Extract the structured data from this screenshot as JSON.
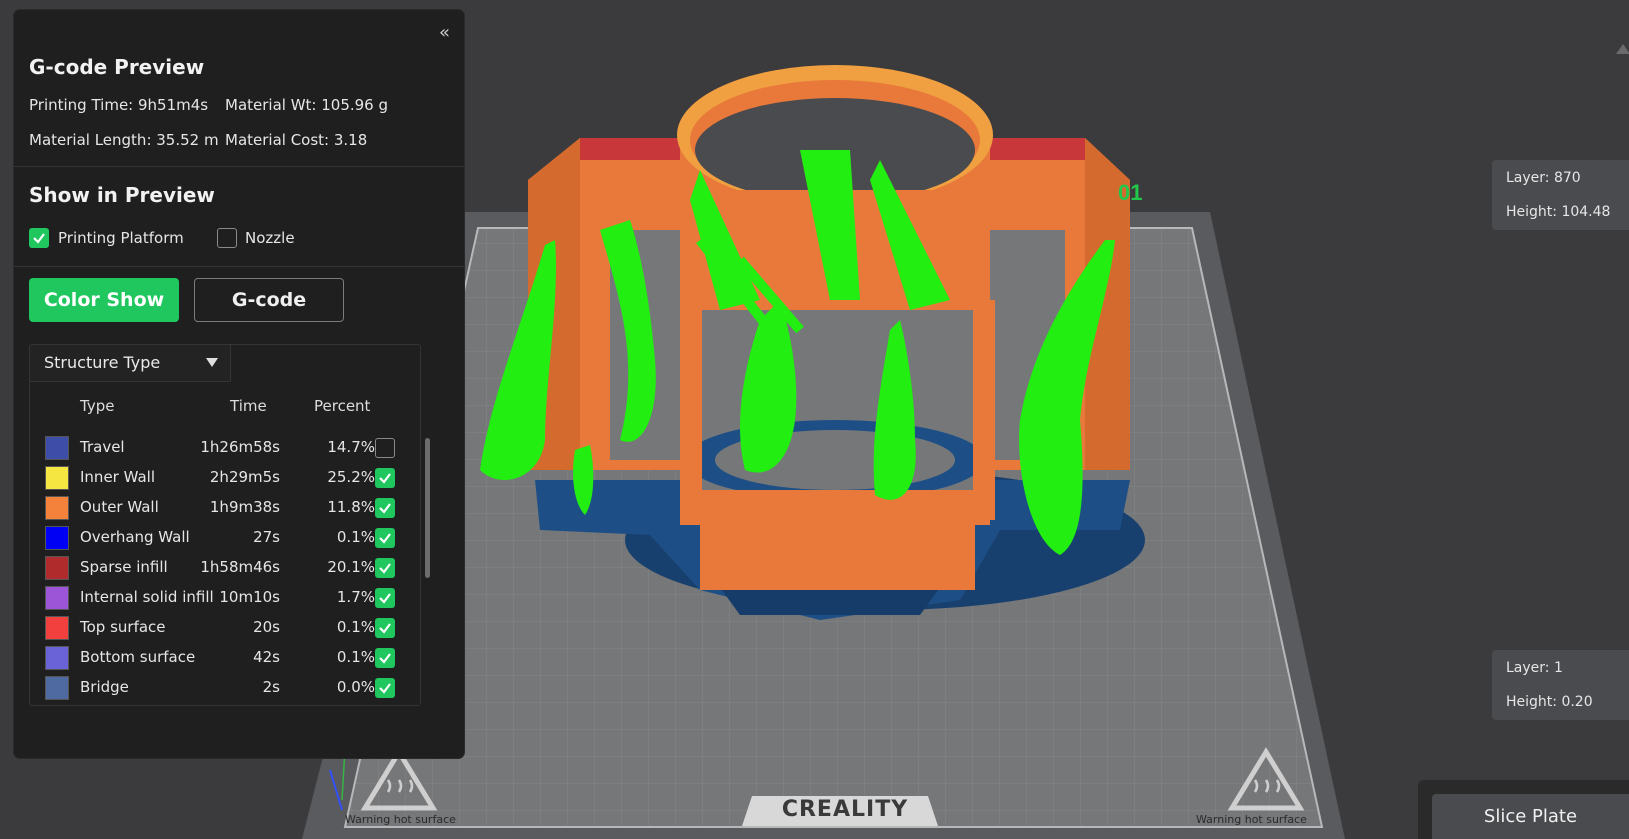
{
  "gcode_preview": {
    "title": "G-code Preview",
    "printing_time": "Printing Time: 9h51m4s",
    "material_wt": "Material Wt: 105.96 g",
    "material_length": "Material Length: 35.52 m",
    "material_cost": "Material Cost: 3.18"
  },
  "show_in_preview": {
    "title": "Show in Preview",
    "printing_platform": {
      "label": "Printing Platform",
      "checked": true
    },
    "nozzle": {
      "label": "Nozzle",
      "checked": false
    }
  },
  "mode_buttons": {
    "color_show": "Color Show",
    "gcode": "G-code"
  },
  "legend": {
    "dropdown_label": "Structure Type",
    "headers": {
      "type": "Type",
      "time": "Time",
      "percent": "Percent"
    },
    "rows": [
      {
        "type": "Travel",
        "time": "1h26m58s",
        "percent": "14.7%",
        "color": "#3e4ea8",
        "checked": false
      },
      {
        "type": "Inner Wall",
        "time": "2h29m5s",
        "percent": "25.2%",
        "color": "#f5e642",
        "checked": true
      },
      {
        "type": "Outer Wall",
        "time": "1h9m38s",
        "percent": "11.8%",
        "color": "#f5823a",
        "checked": true
      },
      {
        "type": "Overhang Wall",
        "time": "27s",
        "percent": "0.1%",
        "color": "#0000f5",
        "checked": true
      },
      {
        "type": "Sparse infill",
        "time": "1h58m46s",
        "percent": "20.1%",
        "color": "#b02c2c",
        "checked": true
      },
      {
        "type": "Internal solid infill",
        "time": "10m10s",
        "percent": "1.7%",
        "color": "#9b55d6",
        "checked": true
      },
      {
        "type": "Top surface",
        "time": "20s",
        "percent": "0.1%",
        "color": "#f2403f",
        "checked": true
      },
      {
        "type": "Bottom surface",
        "time": "42s",
        "percent": "0.1%",
        "color": "#6a63d8",
        "checked": true
      },
      {
        "type": "Bridge",
        "time": "2s",
        "percent": "0.0%",
        "color": "#4e6aa0",
        "checked": true
      }
    ]
  },
  "layer_top": {
    "layer": "Layer: 870",
    "height": "Height: 104.48"
  },
  "layer_bottom": {
    "layer": "Layer: 1",
    "height": "Height: 0.20"
  },
  "slice_plate": "Slice Plate",
  "bed": {
    "brand": "CREALITY",
    "warning_left": "Warning hot surface",
    "warning_right": "Warning hot surface"
  },
  "colors": {
    "accent": "#1fc75e",
    "support": "#22ee11",
    "outer_wall": "#f5823a",
    "brim": "#1d4f86"
  }
}
